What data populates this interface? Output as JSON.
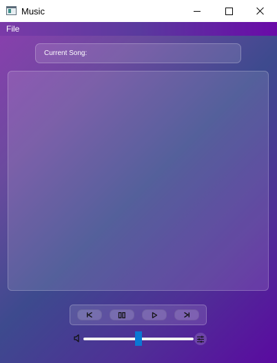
{
  "window": {
    "title": "Music"
  },
  "menu": {
    "file_label": "File"
  },
  "current_song": {
    "label": "Current Song:"
  },
  "playback": {
    "buttons": [
      "previous",
      "pause",
      "play",
      "next"
    ]
  },
  "volume": {
    "level_percent": 50
  },
  "colors": {
    "accent": "#0a78d4",
    "background_start": "#8a3fae",
    "background_end": "#5a0aa0"
  },
  "icons": {
    "app": "music-app-icon",
    "minimize": "minimize-icon",
    "maximize": "maximize-icon",
    "close": "close-icon",
    "previous": "skip-previous-icon",
    "pause": "pause-icon",
    "play": "play-icon",
    "next": "skip-next-icon",
    "mute": "speaker-mute-icon",
    "equalizer": "equalizer-icon"
  }
}
